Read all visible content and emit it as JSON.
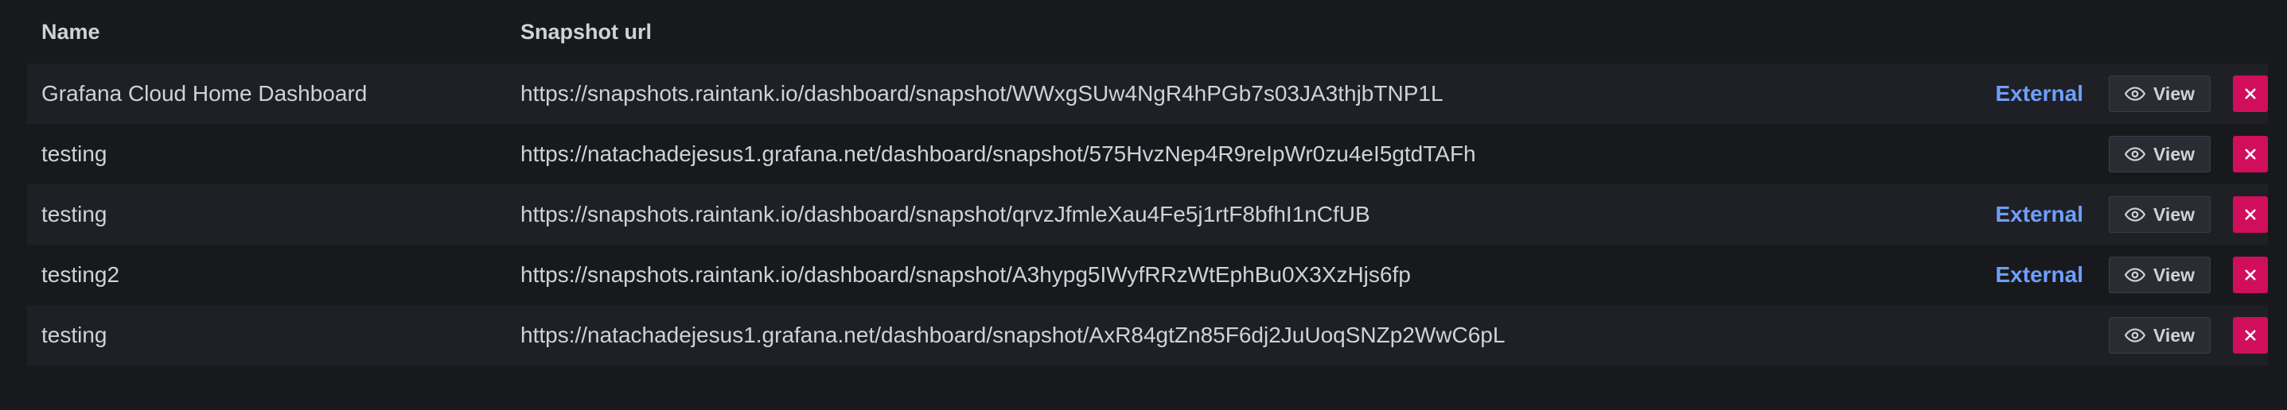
{
  "table": {
    "headers": {
      "name": "Name",
      "url": "Snapshot url"
    },
    "rows": [
      {
        "name": "Grafana Cloud Home Dashboard",
        "url": "https://snapshots.raintank.io/dashboard/snapshot/WWxgSUw4NgR4hPGb7s03JA3thjbTNP1L",
        "external": "External",
        "view_label": "View"
      },
      {
        "name": "testing",
        "url": "https://natachadejesus1.grafana.net/dashboard/snapshot/575HvzNep4R9reIpWr0zu4eI5gtdTAFh",
        "external": "",
        "view_label": "View"
      },
      {
        "name": "testing",
        "url": "https://snapshots.raintank.io/dashboard/snapshot/qrvzJfmleXau4Fe5j1rtF8bfhI1nCfUB",
        "external": "External",
        "view_label": "View"
      },
      {
        "name": "testing2",
        "url": "https://snapshots.raintank.io/dashboard/snapshot/A3hypg5IWyfRRzWtEphBu0X3XzHjs6fp",
        "external": "External",
        "view_label": "View"
      },
      {
        "name": "testing",
        "url": "https://natachadejesus1.grafana.net/dashboard/snapshot/AxR84gtZn85F6dj2JuUoqSNZp2WwC6pL",
        "external": "",
        "view_label": "View"
      }
    ]
  },
  "icons": {
    "view": "eye-icon",
    "delete": "close-icon"
  },
  "colors": {
    "background": "#18191d",
    "row_alt": "#1f2025",
    "external_link": "#6e9fff",
    "delete_button": "#d10e5c"
  }
}
